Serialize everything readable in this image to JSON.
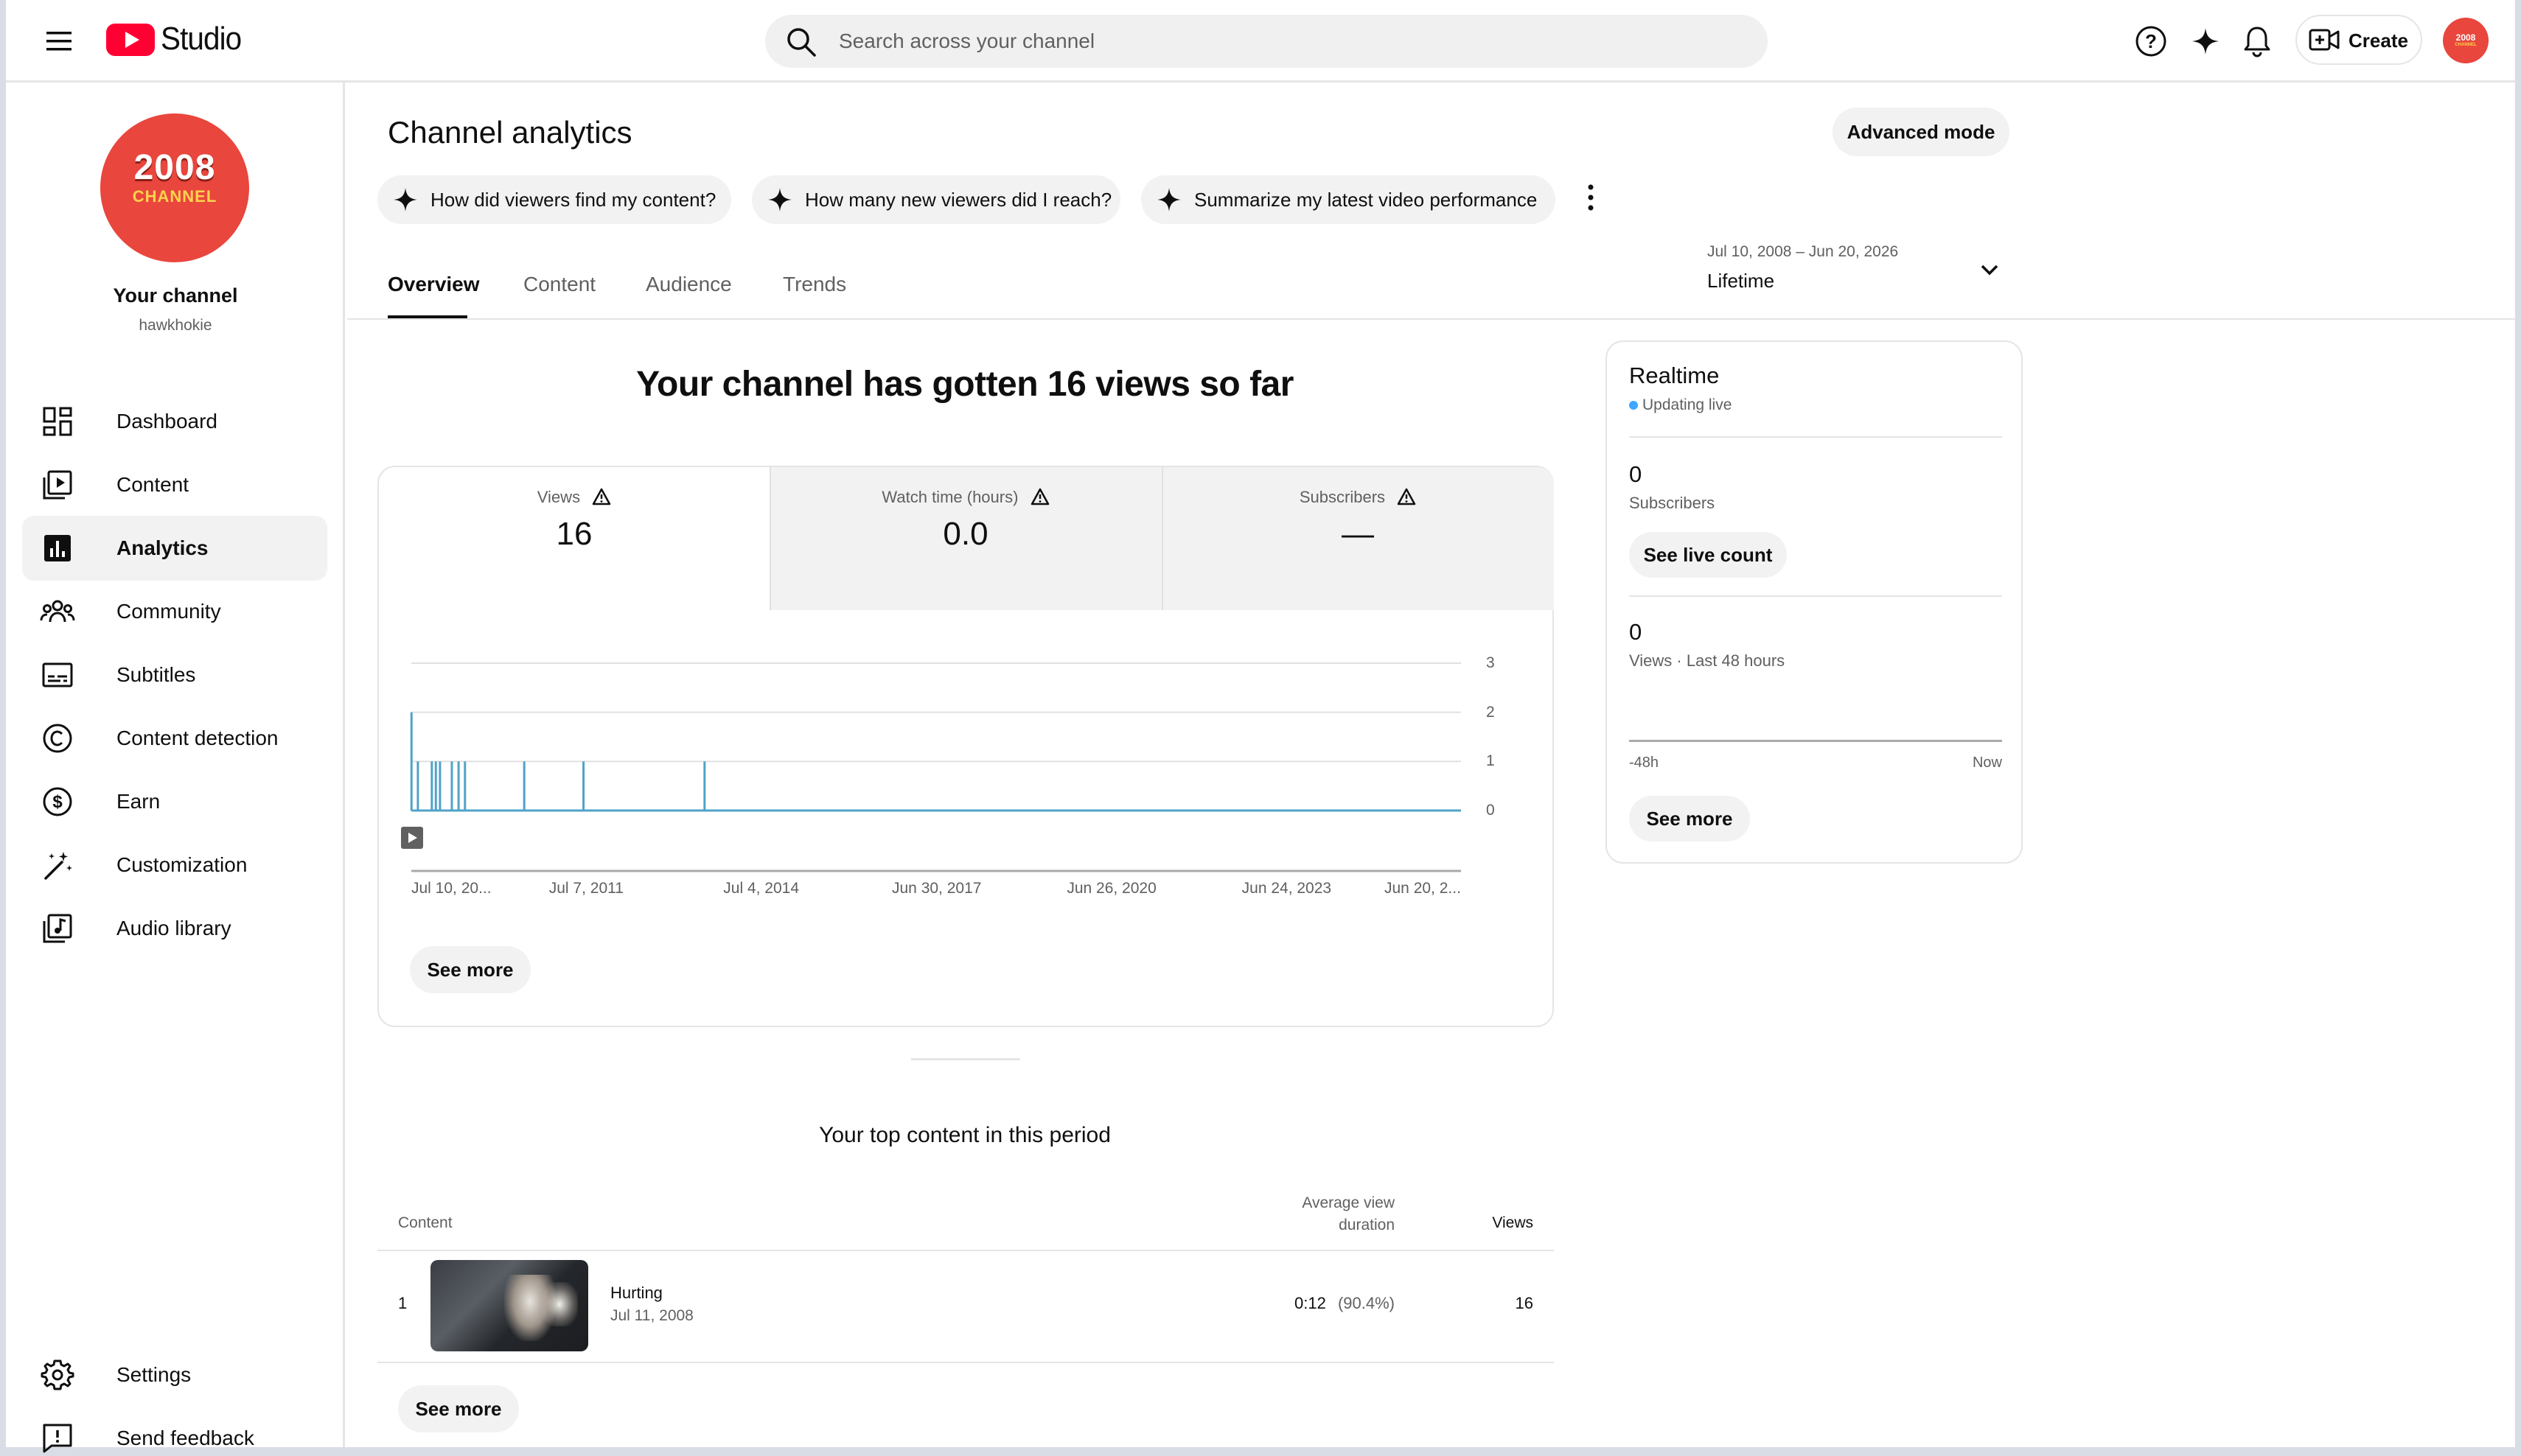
{
  "header": {
    "app_name": "Studio",
    "search_placeholder": "Search across your channel",
    "create_label": "Create"
  },
  "sidebar": {
    "channel_avatar_text_top": "2008",
    "channel_avatar_text_bottom": "CHANNEL",
    "channel_title": "Your channel",
    "channel_handle": "hawkhokie",
    "items": [
      {
        "label": "Dashboard",
        "icon": "dashboard-icon"
      },
      {
        "label": "Content",
        "icon": "content-icon"
      },
      {
        "label": "Analytics",
        "icon": "analytics-icon",
        "active": true
      },
      {
        "label": "Community",
        "icon": "community-icon"
      },
      {
        "label": "Subtitles",
        "icon": "subtitles-icon"
      },
      {
        "label": "Content detection",
        "icon": "copyright-icon"
      },
      {
        "label": "Earn",
        "icon": "dollar-icon"
      },
      {
        "label": "Customization",
        "icon": "magic-wand-icon"
      },
      {
        "label": "Audio library",
        "icon": "audio-library-icon"
      }
    ],
    "bottom_items": [
      {
        "label": "Settings",
        "icon": "gear-icon"
      },
      {
        "label": "Send feedback",
        "icon": "feedback-icon"
      }
    ]
  },
  "main": {
    "title": "Channel analytics",
    "advanced_mode_label": "Advanced mode",
    "chips": [
      "How did viewers find my content?",
      "How many new viewers did I reach?",
      "Summarize my latest video performance"
    ],
    "tabs": [
      "Overview",
      "Content",
      "Audience",
      "Trends"
    ],
    "active_tab": "Overview",
    "date_range": {
      "range": "Jul 10, 2008 – Jun 20, 2026",
      "label": "Lifetime"
    },
    "headline": "Your channel has gotten 16 views so far",
    "metrics": [
      {
        "label": "Views",
        "value": "16"
      },
      {
        "label": "Watch time (hours)",
        "value": "0.0"
      },
      {
        "label": "Subscribers",
        "value": "—"
      }
    ],
    "see_more_label": "See more",
    "top_content": {
      "heading": "Your top content in this period",
      "columns": {
        "content": "Content",
        "avg_view_duration_line1": "Average view",
        "avg_view_duration_line2": "duration",
        "views": "Views"
      },
      "rows": [
        {
          "rank": "1",
          "title": "Hurting",
          "date": "Jul 11, 2008",
          "avg_duration": "0:12",
          "avg_pct": "(90.4%)",
          "views": "16"
        }
      ],
      "see_more_label": "See more"
    }
  },
  "realtime": {
    "title": "Realtime",
    "status": "Updating live",
    "subscribers_value": "0",
    "subscribers_label": "Subscribers",
    "see_live_count_label": "See live count",
    "views_value": "0",
    "views_label": "Views · Last 48 hours",
    "axis_start": "-48h",
    "axis_end": "Now",
    "see_more_label": "See more",
    "status_color": "#3ea6ff"
  },
  "chart_data": {
    "type": "line",
    "title": "",
    "xlabel": "",
    "ylabel": "",
    "x_tick_labels": [
      "Jul 10, 20...",
      "Jul 7, 2011",
      "Jul 4, 2014",
      "Jun 30, 2017",
      "Jun 26, 2020",
      "Jun 24, 2023",
      "Jun 20, 2..."
    ],
    "y_ticks": [
      0,
      1,
      2,
      3
    ],
    "ylim": [
      0,
      3
    ],
    "x": [
      "2008-07-11",
      "2008-08-20",
      "2008-11-15",
      "2008-12-10",
      "2009-01-05",
      "2009-03-20",
      "2009-05-01",
      "2009-06-10",
      "2010-06-15",
      "2011-06-20",
      "2013-07-15"
    ],
    "series": [
      {
        "values": [
          2,
          1,
          1,
          1,
          1,
          1,
          1,
          1,
          1,
          1,
          1
        ]
      }
    ],
    "line_color": "#4fa3c7",
    "grid": true
  }
}
